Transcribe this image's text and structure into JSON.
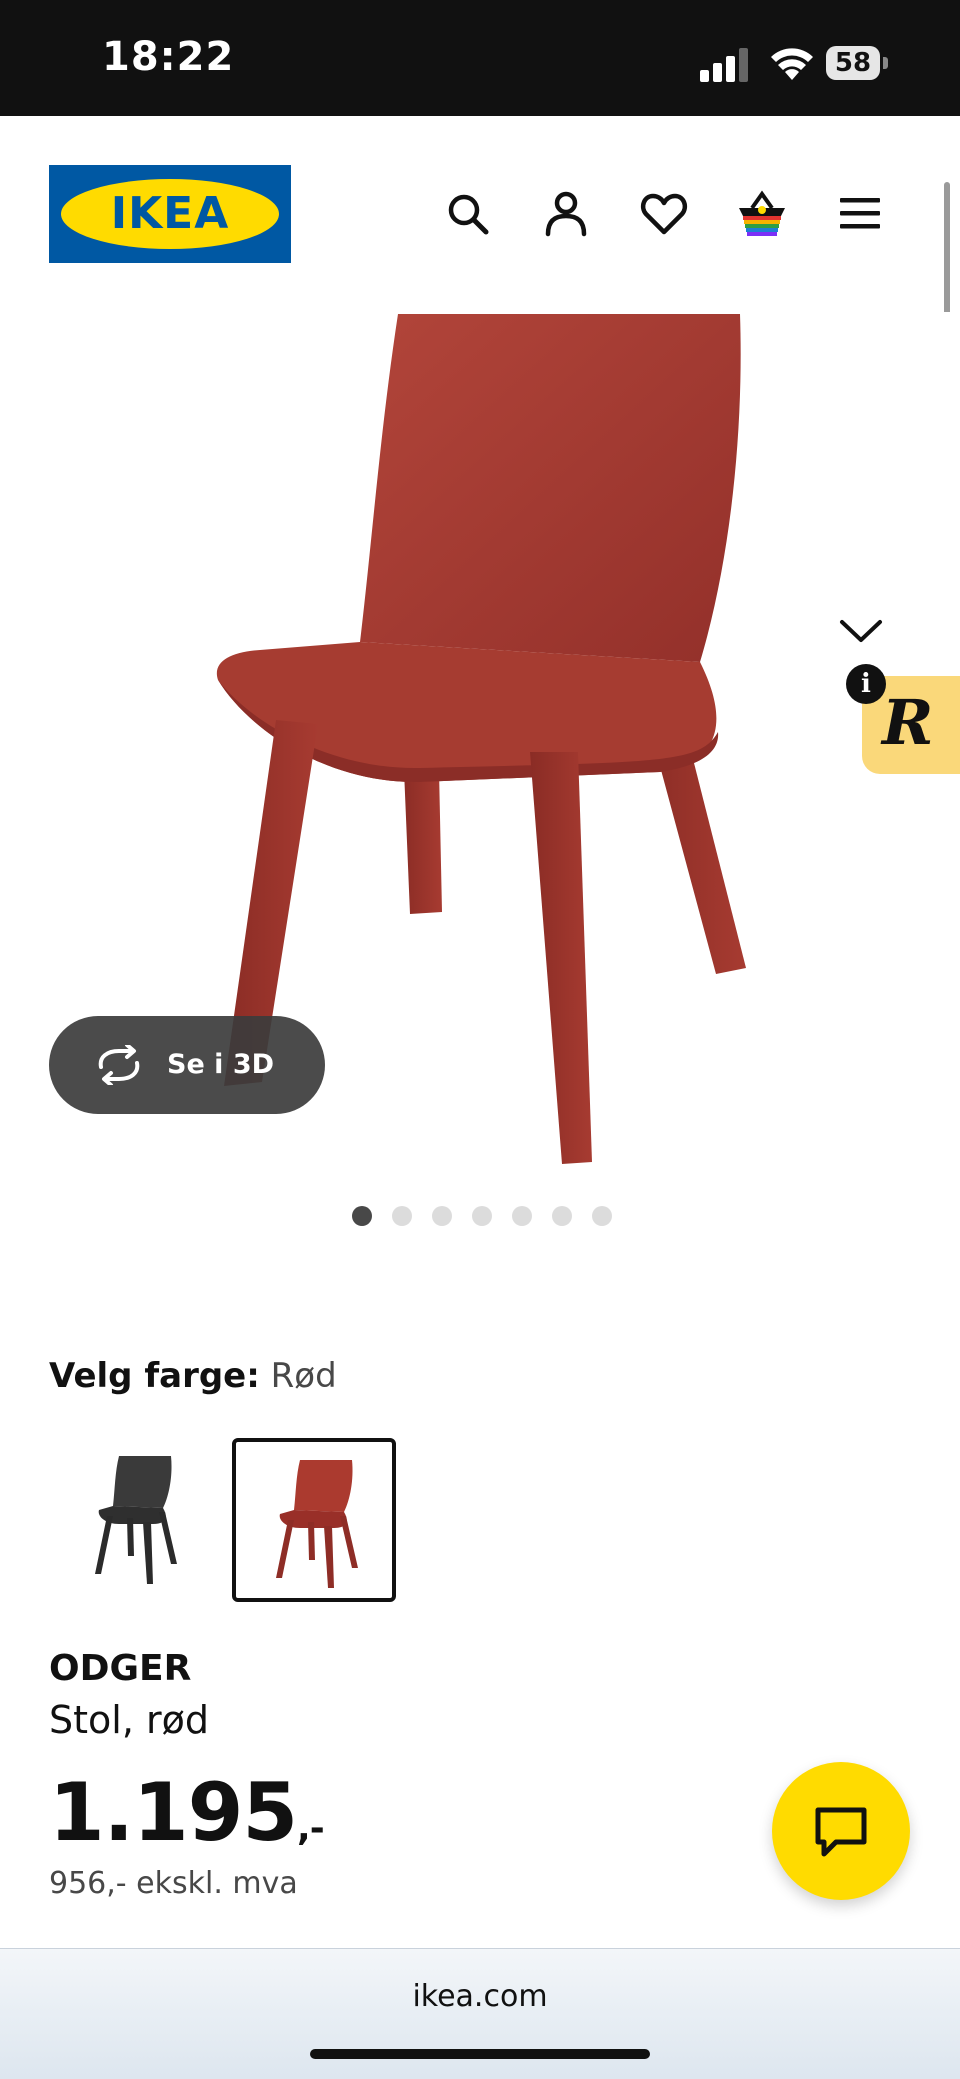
{
  "status_bar": {
    "time": "18:22",
    "battery": "58"
  },
  "header": {
    "logo_text": "IKEA",
    "icons": [
      "search-icon",
      "account-icon",
      "heart-icon",
      "shopping-bag-icon",
      "menu-icon"
    ]
  },
  "gallery": {
    "view_3d_label": "Se i 3D",
    "image_count": 7,
    "active_index": 0
  },
  "color_select": {
    "label": "Velg farge:",
    "value": "Rød",
    "options": [
      {
        "name": "svart",
        "color": "#3a3a3a"
      },
      {
        "name": "rød",
        "color": "#a8382c"
      }
    ],
    "selected_index": 1
  },
  "product": {
    "name": "ODGER",
    "description": "Stol, rød",
    "price": "1.195",
    "price_suffix": ",-",
    "price_excl_vat": "956,- ekskl. mva"
  },
  "widget": {
    "letter": "R",
    "info": "i"
  },
  "browser": {
    "url": "ikea.com"
  },
  "colors": {
    "ikea_blue": "#0058a3",
    "ikea_yellow": "#ffdb00",
    "chair_red": "#a8382c"
  }
}
